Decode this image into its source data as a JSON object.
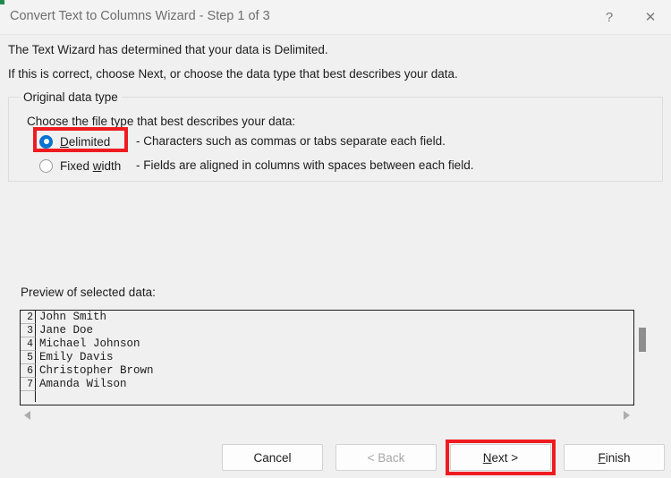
{
  "window": {
    "title": "Convert Text to Columns Wizard - Step 1 of 3",
    "help_glyph": "?",
    "close_glyph": "✕"
  },
  "intro": {
    "line1": "The Text Wizard has determined that your data is Delimited.",
    "line2": "If this is correct, choose Next, or choose the data type that best describes your data."
  },
  "group": {
    "legend": "Original data type",
    "choose_label": "Choose the file type that best describes your data:",
    "options": [
      {
        "label_prefix": "",
        "accel": "D",
        "label_suffix": "elimited",
        "description": "- Characters such as commas or tabs separate each field.",
        "selected": true,
        "highlighted": true
      },
      {
        "label_prefix": "Fixed ",
        "accel": "w",
        "label_suffix": "idth",
        "description": "- Fields are aligned in columns with spaces between each field.",
        "selected": false,
        "highlighted": false
      }
    ]
  },
  "preview": {
    "label": "Preview of selected data:",
    "rows": [
      {
        "num": "2",
        "text": "John Smith"
      },
      {
        "num": "3",
        "text": "Jane Doe"
      },
      {
        "num": "4",
        "text": "Michael Johnson"
      },
      {
        "num": "5",
        "text": "Emily Davis"
      },
      {
        "num": "6",
        "text": "Christopher Brown"
      },
      {
        "num": "7",
        "text": "Amanda Wilson"
      }
    ]
  },
  "footer": {
    "cancel": "Cancel",
    "back": "< Back",
    "next_prefix": "",
    "next_accel": "N",
    "next_suffix": "ext >",
    "finish_prefix": "",
    "finish_accel": "F",
    "finish_suffix": "inish"
  },
  "colors": {
    "highlight": "#ee1c21",
    "radio_accent": "#0a72d1",
    "dialog_bg": "#f0f0f0",
    "titlebar_bg": "#f3f3f3"
  }
}
